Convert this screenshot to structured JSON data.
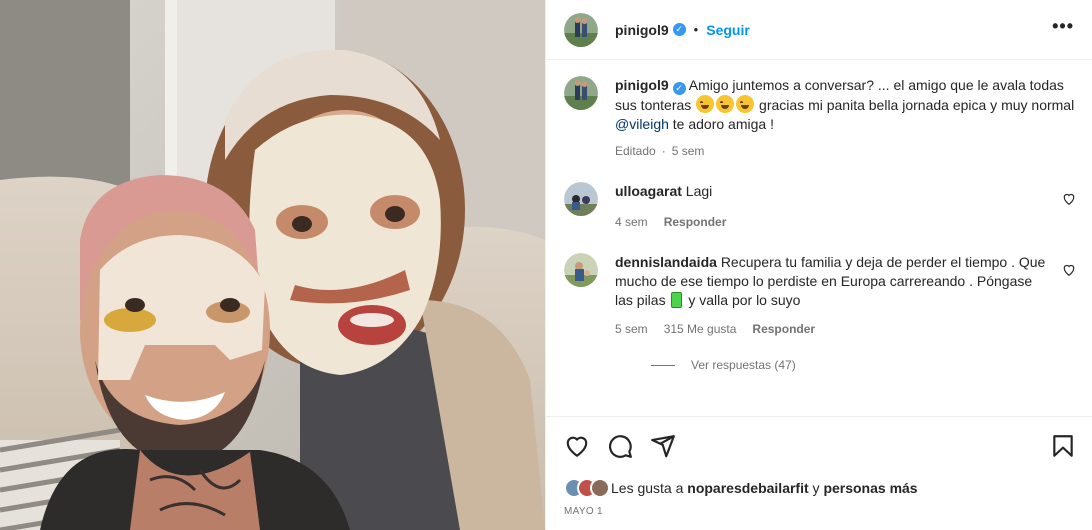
{
  "post": {
    "username": "pinigol9",
    "follow_label": "Seguir",
    "separator": "•",
    "more_label": "•••"
  },
  "caption": {
    "username": "pinigol9",
    "text_before_emojis": "Amigo juntemos a conversar? ... el amigo que le avala todas sus tonteras",
    "text_after_emojis": "gracias mi panita bella jornada epica y muy normal",
    "mention": "@vileigh",
    "text_end": "te adoro amiga !",
    "edited": "Editado",
    "time": "5 sem"
  },
  "comments": [
    {
      "username": "ulloagarat",
      "text": "Lagi",
      "time": "4 sem",
      "reply_label": "Responder"
    },
    {
      "username": "dennislandaida",
      "text_part1": "Recupera tu familia y deja de perder el tiempo . Que mucho de ese tiempo lo perdiste en Europa carrereando . Póngase las pilas",
      "text_part2": "y valla por lo suyo",
      "time": "5 sem",
      "likes": "315 Me gusta",
      "reply_label": "Responder",
      "view_replies": "Ver respuestas (47)"
    }
  ],
  "likes": {
    "prefix": "Les gusta a",
    "user": "noparesdebailarfit",
    "connector": "y",
    "others": "personas más"
  },
  "date": "MAYO 1",
  "icons": [
    "verified-badge-icon",
    "heart-icon",
    "comment-icon",
    "share-icon",
    "bookmark-icon",
    "more-options-icon"
  ],
  "colors": {
    "accent": "#0095f6",
    "verified": "#3897f0",
    "text": "#262626",
    "muted": "#737373",
    "mention": "#00376b"
  }
}
